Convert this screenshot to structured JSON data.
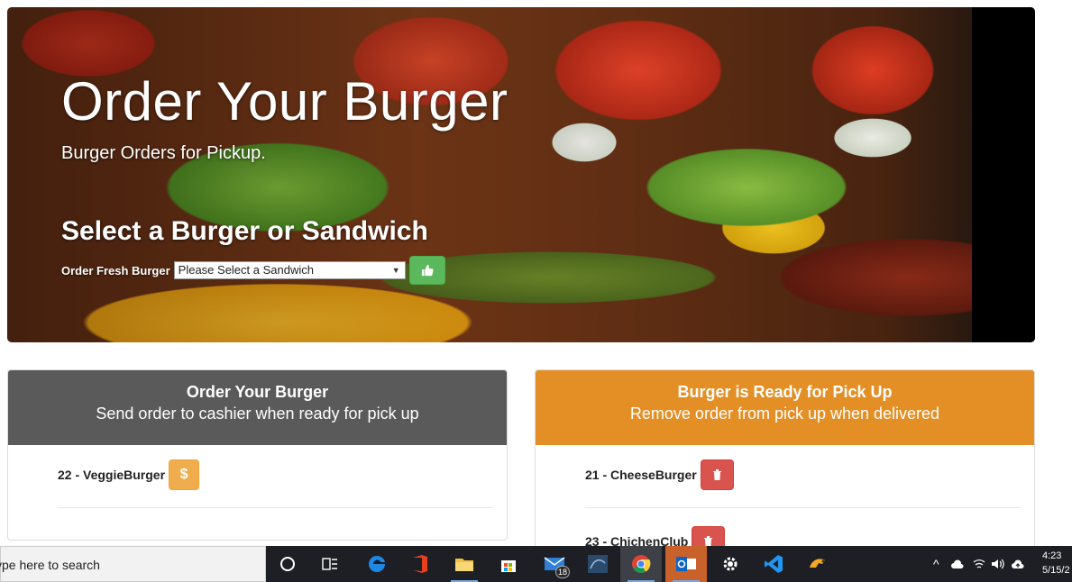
{
  "hero": {
    "title": "Order Your Burger",
    "subtitle": "Burger Orders for Pickup.",
    "select_heading": "Select a Burger or Sandwich",
    "order_label": "Order Fresh Burger",
    "select_value": "Please Select a Sandwich",
    "submit_icon": "thumbs-up-icon"
  },
  "left_panel": {
    "heading": "Order Your Burger",
    "subheading": "Send order to cashier when ready for pick up",
    "items": [
      {
        "label": "22 - VeggieBurger",
        "action_icon": "dollar-icon",
        "action_glyph": "$"
      }
    ]
  },
  "right_panel": {
    "heading": "Burger is Ready for Pick Up",
    "subheading": "Remove order from pick up when delivered",
    "items": [
      {
        "label": "21 - CheeseBurger",
        "action_icon": "trash-icon"
      },
      {
        "label": "23 - ChichenClub",
        "action_icon": "trash-icon"
      }
    ]
  },
  "taskbar": {
    "search_placeholder": "ype here to search",
    "mail_badge": "18",
    "clock_time": "4:23",
    "clock_date": "5/15/2",
    "apps": [
      "cortana-icon",
      "task-view-icon",
      "edge-icon",
      "office-icon",
      "file-explorer-icon",
      "store-icon",
      "mail-icon",
      "sql-icon",
      "chrome-icon",
      "outlook-icon",
      "settings-icon",
      "vscode-icon",
      "app-icon"
    ]
  },
  "colors": {
    "left_panel_header": "#5a5a5a",
    "right_panel_header": "#e48f25",
    "success": "#5cb85c",
    "warning": "#f0ad4e",
    "danger": "#d9534f"
  }
}
